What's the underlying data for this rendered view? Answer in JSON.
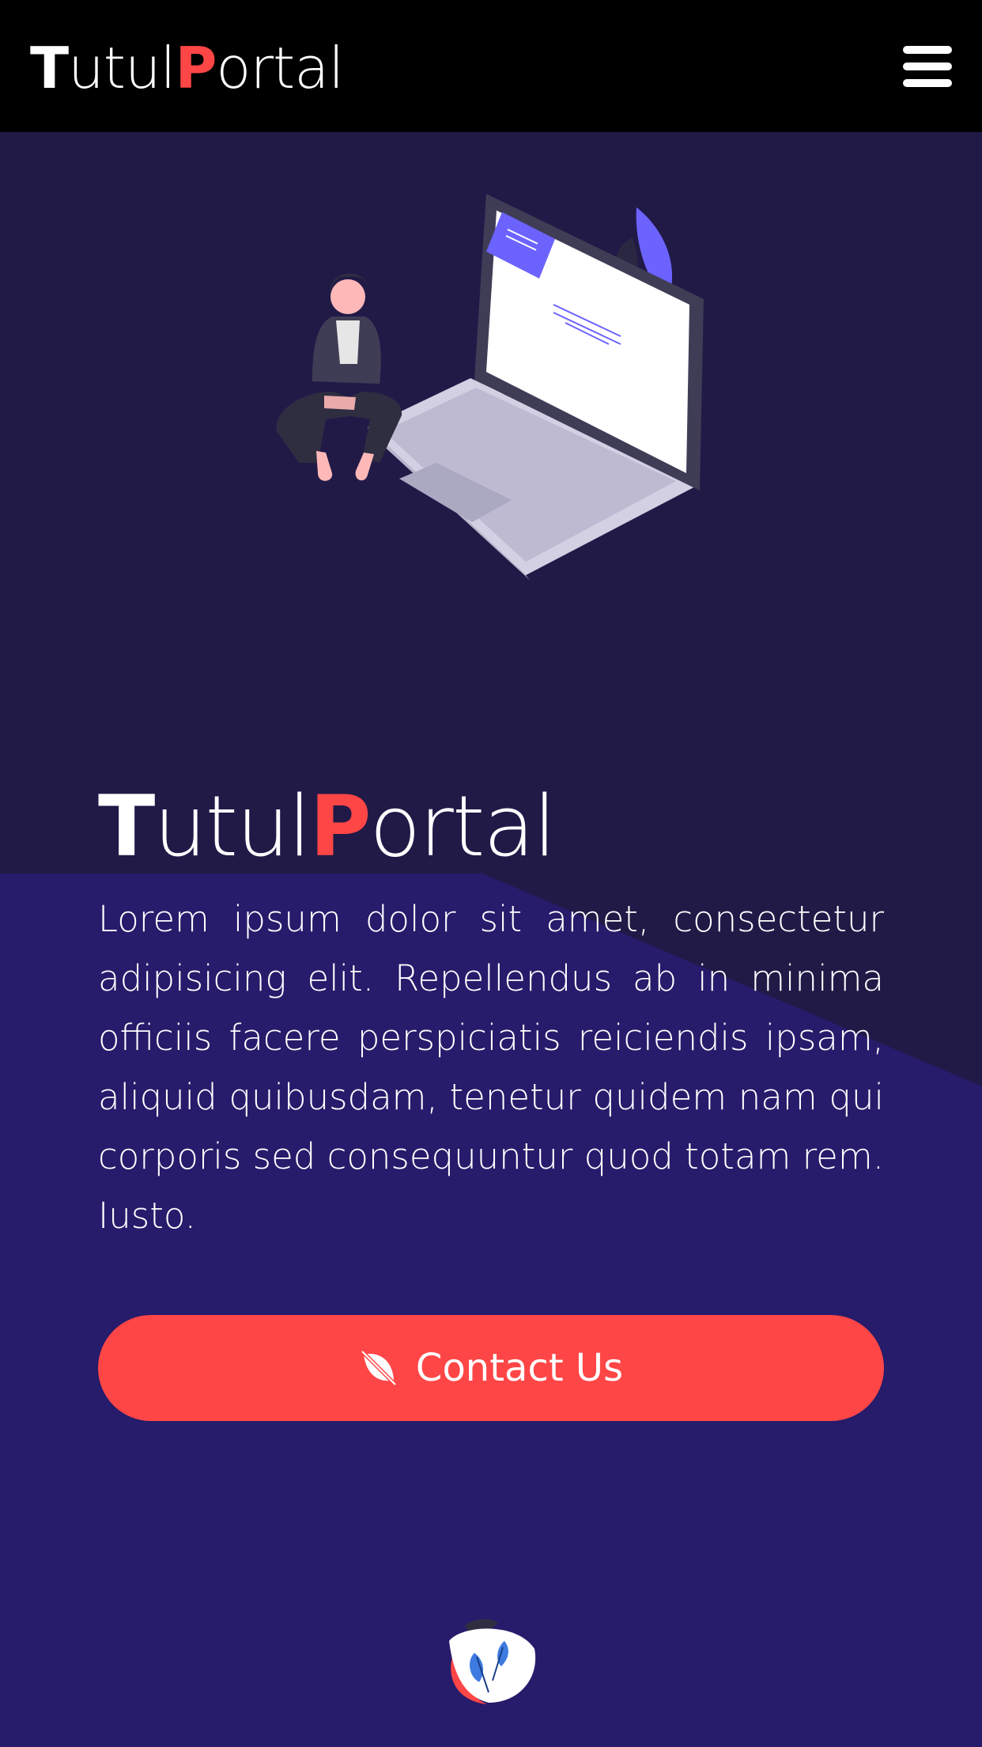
{
  "brand": {
    "part1": "T",
    "part2": "utul",
    "part3": "P",
    "part4": "ortal"
  },
  "nav": {
    "menu_icon": "hamburger-menu-icon"
  },
  "hero": {
    "title_part1": "T",
    "title_part2": "utul",
    "title_part3": "P",
    "title_part4": "ortal",
    "text": "Lorem ipsum dolor sit amet, consectetur adipisicing elit. Repellendus ab in minima officiis facere perspiciatis reiciendis ipsam, aliquid quibusdam, tenetur quidem nam qui corporis sed consequuntur quod totam rem. Iusto.",
    "cta_label": "Contact Us",
    "cta_icon": "leaf-slash-icon",
    "illustration": "woman-sitting-on-laptop-illustration"
  },
  "footer": {
    "logo": "circular-feather-logo"
  },
  "colors": {
    "nav_bg": "#000000",
    "hero_dark": "#211a47",
    "hero_purple": "#271b6b",
    "accent": "#ff4646",
    "illustration_purple": "#6c63ff"
  }
}
